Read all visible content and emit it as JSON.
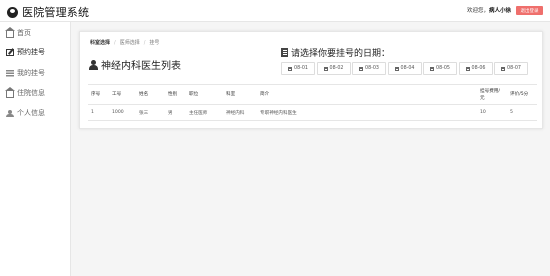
{
  "app": {
    "title": "医院管理系统"
  },
  "header": {
    "welcome_prefix": "欢迎您，",
    "user_name": "病人小徐",
    "logout_label": "退出登录"
  },
  "sidebar": {
    "items": [
      {
        "label": "首页",
        "icon": "home-icon"
      },
      {
        "label": "预约挂号",
        "icon": "edit-icon",
        "active": true
      },
      {
        "label": "我的挂号",
        "icon": "list-icon"
      },
      {
        "label": "住院信息",
        "icon": "home-icon"
      },
      {
        "label": "个人信息",
        "icon": "user-icon"
      }
    ]
  },
  "breadcrumb": [
    "科室选择",
    "医师选择",
    "挂号"
  ],
  "main": {
    "list_title": "神经内科医生列表",
    "date_prompt": "请选择你要挂号的日期：",
    "dates": [
      "08-01",
      "08-02",
      "08-03",
      "08-04",
      "08-05",
      "08-06",
      "08-07"
    ]
  },
  "table": {
    "headers": [
      "序号",
      "工号",
      "姓名",
      "性别",
      "职位",
      "科室",
      "简介",
      "挂号费用/元",
      "评价/5分"
    ],
    "rows": [
      [
        "1",
        "1000",
        "张三",
        "男",
        "主任医师",
        "神经内科",
        "专职神经内科医生",
        "10",
        "5"
      ]
    ]
  }
}
